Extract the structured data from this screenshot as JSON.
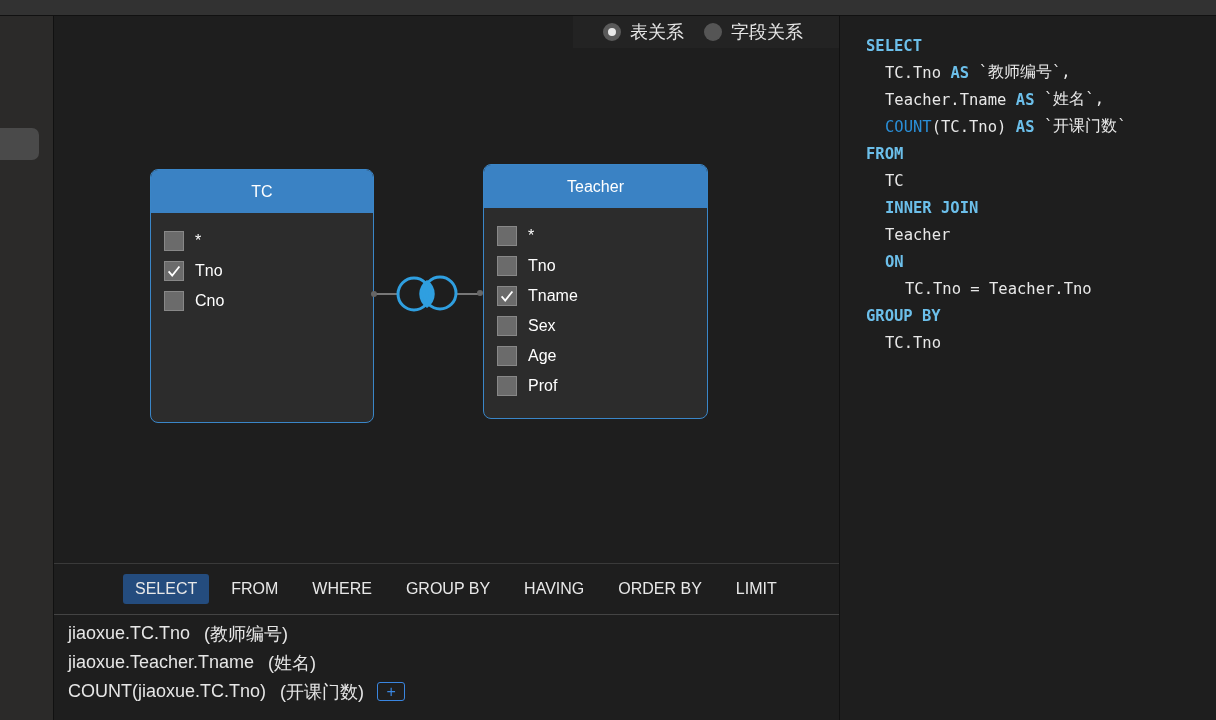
{
  "view_mode": [
    {
      "label": "表关系",
      "selected": true
    },
    {
      "label": "字段关系",
      "selected": false
    }
  ],
  "tables": [
    {
      "name": "TC",
      "fields": [
        {
          "label": "*",
          "checked": false
        },
        {
          "label": "Tno",
          "checked": true
        },
        {
          "label": "Cno",
          "checked": false
        }
      ]
    },
    {
      "name": "Teacher",
      "fields": [
        {
          "label": "*",
          "checked": false
        },
        {
          "label": "Tno",
          "checked": false
        },
        {
          "label": "Tname",
          "checked": true
        },
        {
          "label": "Sex",
          "checked": false
        },
        {
          "label": "Age",
          "checked": false
        },
        {
          "label": "Prof",
          "checked": false
        }
      ]
    }
  ],
  "clause_tabs": [
    {
      "label": "SELECT",
      "selected": true
    },
    {
      "label": "FROM",
      "selected": false
    },
    {
      "label": "WHERE",
      "selected": false
    },
    {
      "label": "GROUP BY",
      "selected": false
    },
    {
      "label": "HAVING",
      "selected": false
    },
    {
      "label": "ORDER BY",
      "selected": false
    },
    {
      "label": "LIMIT",
      "selected": false
    }
  ],
  "select_items": [
    {
      "expression": "jiaoxue.TC.Tno",
      "alias": "(教师编号)"
    },
    {
      "expression": "jiaoxue.Teacher.Tname",
      "alias": "(姓名)"
    },
    {
      "expression": "COUNT(jiaoxue.TC.Tno)",
      "alias": "(开课门数)"
    }
  ],
  "add_button": "+",
  "sql": [
    {
      "kind": "clause",
      "tokens": [
        {
          "kind": "keyword",
          "text": "SELECT"
        }
      ]
    },
    {
      "kind": "item",
      "tokens": [
        {
          "kind": "plain",
          "text": "TC.Tno"
        },
        {
          "kind": "keyword",
          "text": "AS"
        },
        {
          "kind": "plain",
          "text": "`教师编号`,"
        }
      ]
    },
    {
      "kind": "item",
      "tokens": [
        {
          "kind": "plain",
          "text": "Teacher.Tname"
        },
        {
          "kind": "keyword",
          "text": "AS"
        },
        {
          "kind": "plain",
          "text": "`姓名`,"
        }
      ]
    },
    {
      "kind": "item",
      "tokens": [
        {
          "kind": "function",
          "text": "COUNT"
        },
        {
          "kind": "plain",
          "text": "(TC.Tno)"
        },
        {
          "kind": "keyword",
          "text": "AS"
        },
        {
          "kind": "plain",
          "text": "`开课门数`"
        }
      ]
    },
    {
      "kind": "clause",
      "tokens": [
        {
          "kind": "keyword",
          "text": "FROM"
        }
      ]
    },
    {
      "kind": "item",
      "tokens": [
        {
          "kind": "plain",
          "text": "TC"
        }
      ]
    },
    {
      "kind": "item",
      "tokens": [
        {
          "kind": "keyword",
          "text": "INNER JOIN"
        }
      ]
    },
    {
      "kind": "item",
      "tokens": [
        {
          "kind": "plain",
          "text": "Teacher"
        }
      ]
    },
    {
      "kind": "item",
      "tokens": [
        {
          "kind": "keyword",
          "text": "ON"
        }
      ]
    },
    {
      "kind": "condition",
      "tokens": [
        {
          "kind": "plain",
          "text": "TC.Tno = Teacher.Tno"
        }
      ]
    },
    {
      "kind": "clause",
      "tokens": [
        {
          "kind": "keyword",
          "text": "GROUP BY"
        }
      ]
    },
    {
      "kind": "item",
      "tokens": [
        {
          "kind": "plain",
          "text": "TC.Tno"
        }
      ]
    }
  ]
}
